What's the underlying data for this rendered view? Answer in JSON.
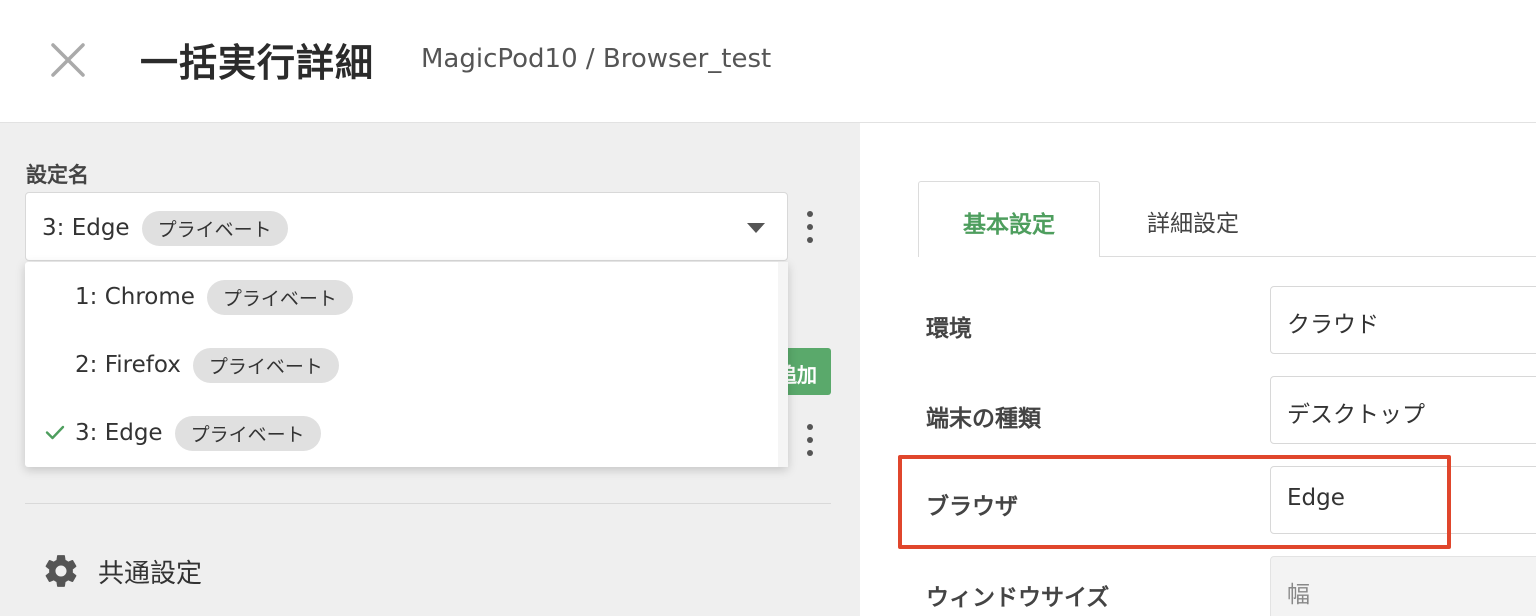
{
  "header": {
    "title": "一括実行詳細",
    "breadcrumb": "MagicPod10 / Browser_test",
    "close_icon": "close-icon"
  },
  "left_panel": {
    "settings_label": "設定名",
    "selected": {
      "name": "3: Edge",
      "badge": "プライベート"
    },
    "add_button_label": "追加",
    "dropdown_options": [
      {
        "name": "1: Chrome",
        "badge": "プライベート",
        "selected": false
      },
      {
        "name": "2: Firefox",
        "badge": "プライベート",
        "selected": false
      },
      {
        "name": "3: Edge",
        "badge": "プライベート",
        "selected": true
      }
    ],
    "common_settings": {
      "icon": "gear-icon",
      "label": "共通設定"
    }
  },
  "right_panel": {
    "tabs": [
      {
        "label": "基本設定",
        "active": true
      },
      {
        "label": "詳細設定",
        "active": false
      }
    ],
    "fields": [
      {
        "label": "環境",
        "value": "クラウド"
      },
      {
        "label": "端末の種類",
        "value": "デスクトップ"
      },
      {
        "label": "ブラウザ",
        "value": "Edge"
      },
      {
        "label": "ウィンドウサイズ",
        "placeholder": "幅"
      }
    ]
  },
  "colors": {
    "accent_green": "#4e9e5e",
    "add_button": "#5aa96b",
    "highlight_red": "#e0462c",
    "left_panel_bg": "#efefef"
  }
}
